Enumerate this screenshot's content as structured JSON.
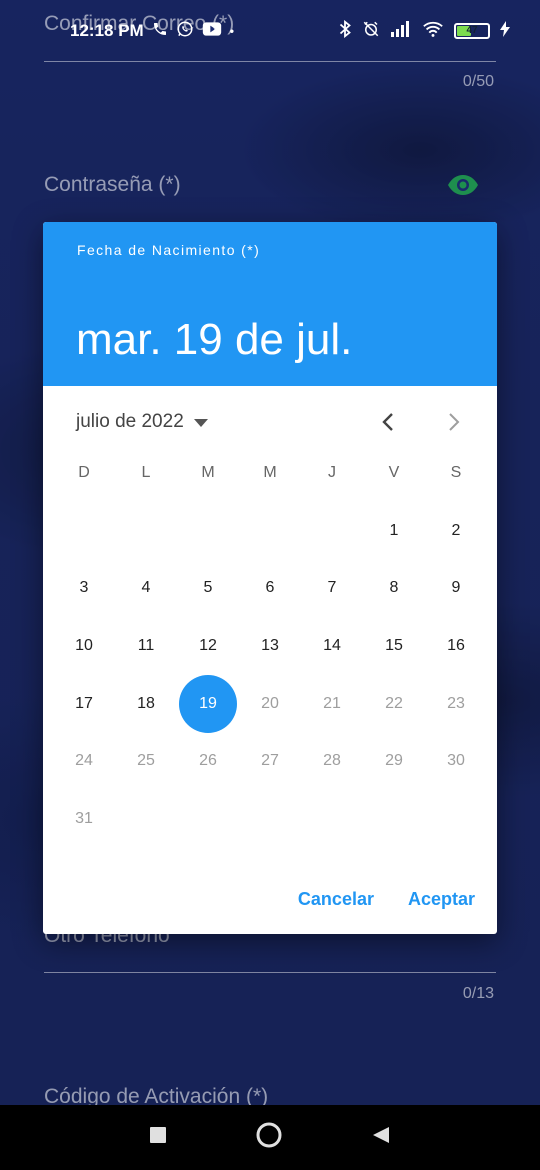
{
  "status_bar": {
    "time": "12:18 PM",
    "battery": "47"
  },
  "background_form": {
    "confirm_email_label": "Confirmar Correo (*)",
    "confirm_email_counter": "0/50",
    "password_label": "Contraseña (*)",
    "other_phone_label": "Otro Teléfono",
    "other_phone_counter": "0/13",
    "activation_code_label": "Código de Activación (*)"
  },
  "dialog": {
    "subtitle": "Fecha de Nacimiento (*)",
    "selected_date": "mar. 19 de jul.",
    "month_year": "julio de 2022",
    "weekdays": [
      "D",
      "L",
      "M",
      "M",
      "J",
      "V",
      "S"
    ],
    "weeks": [
      [
        "",
        "",
        "",
        "",
        "",
        "1",
        "2"
      ],
      [
        "3",
        "4",
        "5",
        "6",
        "7",
        "8",
        "9"
      ],
      [
        "10",
        "11",
        "12",
        "13",
        "14",
        "15",
        "16"
      ],
      [
        "17",
        "18",
        "19",
        "20",
        "21",
        "22",
        "23"
      ],
      [
        "24",
        "25",
        "26",
        "27",
        "28",
        "29",
        "30"
      ],
      [
        "31",
        "",
        "",
        "",
        "",
        "",
        ""
      ]
    ],
    "selected_day": "19",
    "last_enabled_day": 19,
    "cancel_label": "Cancelar",
    "accept_label": "Aceptar"
  },
  "colors": {
    "accent": "#2196f3",
    "eye_icon": "#1e8f4e",
    "background": "#1a2a6c"
  }
}
